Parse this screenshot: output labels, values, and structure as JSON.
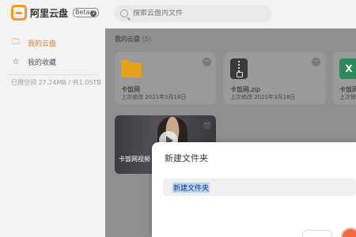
{
  "app": {
    "name": "阿里云盘",
    "beta_label": "Beta",
    "beta_badge": "2"
  },
  "search": {
    "placeholder": "搜索云盘内文件"
  },
  "sidebar": {
    "items": [
      {
        "label": "我的云盘",
        "icon": "folder-icon",
        "active": true
      },
      {
        "label": "我的收藏",
        "icon": "star-icon",
        "active": false
      }
    ],
    "storage": "已用空间 27.24MB / 共1.05TB"
  },
  "main": {
    "section_title": "我的云盘",
    "count": "(5)",
    "files": [
      {
        "name": "卡饭网",
        "date": "上次修改 2021年3月18日",
        "type": "folder"
      },
      {
        "name": "卡饭网.zip",
        "date": "上次修改 2021年3月18日",
        "type": "zip"
      },
      {
        "name": "卡饭网",
        "date": "上次修改",
        "type": "xls"
      },
      {
        "name": "卡饭网视频",
        "type": "video"
      }
    ],
    "more_glyph": "···"
  },
  "dialog": {
    "title": "新建文件夹",
    "input_value": "新建文件夹"
  },
  "colors": {
    "accent": "#e67e22",
    "brand": "#f39a1e",
    "confirm": "#f26a3e"
  }
}
